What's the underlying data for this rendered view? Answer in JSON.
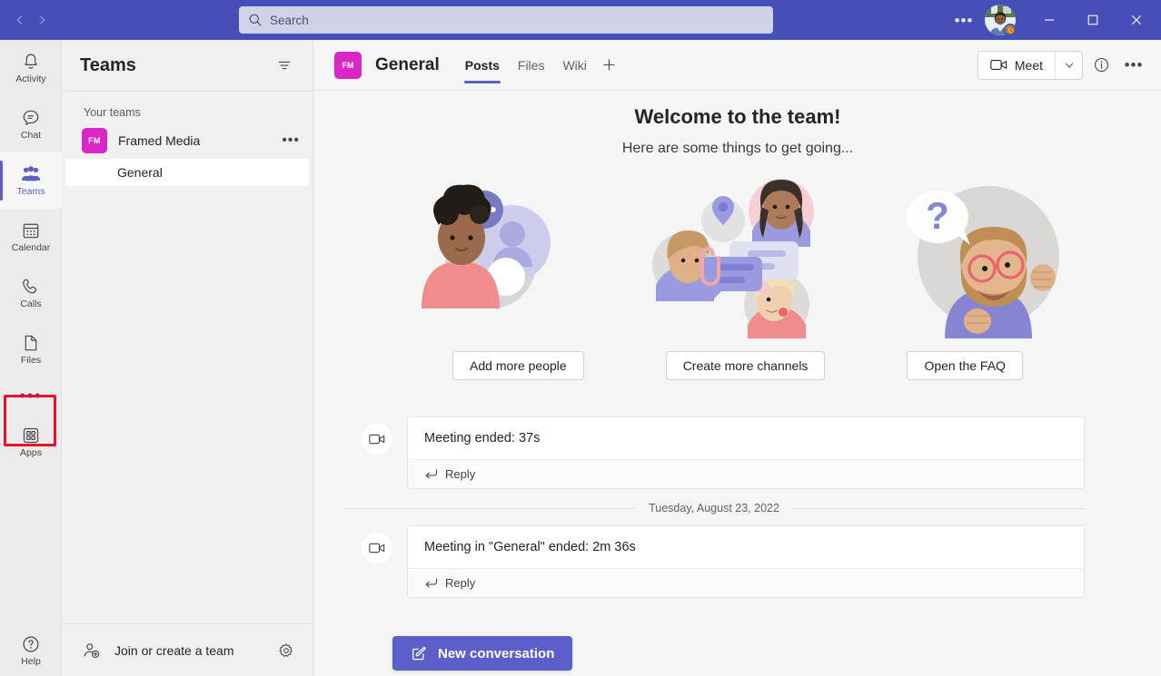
{
  "titlebar": {
    "back_icon": "chevron-left-icon",
    "forward_icon": "chevron-right-icon",
    "search_placeholder": "Search",
    "search_value": "",
    "more_options_label": "•••",
    "avatar_status": "away",
    "minimize_label": "–",
    "maximize_label": "☐",
    "close_label": "✕",
    "bg_color": "#464eb8"
  },
  "rail": {
    "items": [
      {
        "label": "Activity",
        "icon": "bell-icon",
        "active": false
      },
      {
        "label": "Chat",
        "icon": "chat-icon",
        "active": false
      },
      {
        "label": "Teams",
        "icon": "teams-people-icon",
        "active": true
      },
      {
        "label": "Calendar",
        "icon": "calendar-icon",
        "active": false
      },
      {
        "label": "Calls",
        "icon": "phone-icon",
        "active": false
      },
      {
        "label": "Files",
        "icon": "file-icon",
        "active": false
      }
    ],
    "more_label": "•••",
    "apps": {
      "label": "Apps",
      "icon": "apps-grid-icon",
      "highlighted": true,
      "highlight_color": "#e8112d"
    },
    "help": {
      "label": "Help",
      "icon": "question-circle-icon"
    }
  },
  "teams_panel": {
    "title": "Teams",
    "filter_icon": "filter-icon",
    "section_label": "Your teams",
    "teams": [
      {
        "name": "Framed Media",
        "initials": "FM",
        "avatar_color": "#d926c4",
        "more_label": "•••",
        "channels": [
          {
            "name": "General",
            "selected": true
          }
        ]
      }
    ],
    "footer": {
      "join_label": "Join or create a team",
      "join_icon": "person-add-icon",
      "settings_icon": "gear-icon"
    }
  },
  "channel": {
    "team_initials": "FM",
    "team_avatar_color": "#d926c4",
    "title": "General",
    "tabs": [
      {
        "label": "Posts",
        "active": true
      },
      {
        "label": "Files",
        "active": false
      },
      {
        "label": "Wiki",
        "active": false
      }
    ],
    "add_tab_label": "+",
    "meet_label": "Meet",
    "meet_icon": "video-camera-icon",
    "meet_caret_icon": "chevron-down-icon",
    "info_icon": "info-circle-icon",
    "more_icon": "more-horizontal-icon"
  },
  "welcome": {
    "title": "Welcome to the team!",
    "subtitle": "Here are some things to get going...",
    "illustrations": [
      {
        "name": "add-people-illustration"
      },
      {
        "name": "channels-conversation-illustration"
      },
      {
        "name": "faq-question-illustration"
      }
    ],
    "actions": [
      {
        "label": "Add more people"
      },
      {
        "label": "Create more channels"
      },
      {
        "label": "Open the FAQ"
      }
    ]
  },
  "messages": [
    {
      "icon": "video-camera-icon",
      "text": "Meeting ended: 37s",
      "reply_label": "Reply",
      "reply_icon": "reply-arrow-icon"
    },
    {
      "icon": "video-camera-icon",
      "text": "Meeting in \"General\" ended: 2m 36s",
      "reply_label": "Reply",
      "reply_icon": "reply-arrow-icon"
    }
  ],
  "date_divider": "Tuesday, August 23, 2022",
  "composer": {
    "new_conversation_label": "New conversation",
    "new_conversation_icon": "compose-pencil-icon",
    "accent_color": "#5b5fc7"
  }
}
